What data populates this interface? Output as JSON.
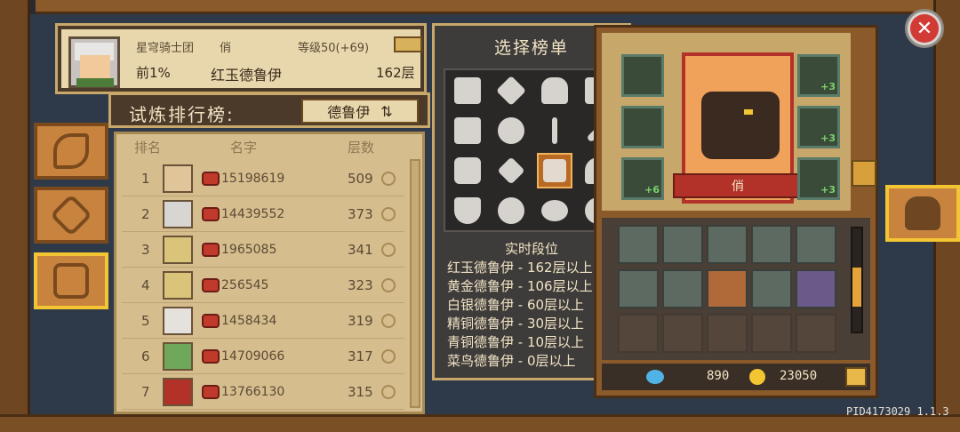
{
  "profile": {
    "guild": "星穹骑士团",
    "title": "俏",
    "level": "等级50(+69)",
    "rank": "前1%",
    "tier": "红玉德鲁伊",
    "floor": "162层"
  },
  "trial": {
    "label": "试炼排行榜:",
    "selected_class": "德鲁伊",
    "swap_icon": "swap-arrows-icon"
  },
  "leaderboard": {
    "headers": {
      "rank": "排名",
      "name": "名字",
      "floors": "层数"
    },
    "rows": [
      {
        "rank": "1",
        "uid": "15198619",
        "floors": "509"
      },
      {
        "rank": "2",
        "uid": "14439552",
        "floors": "373"
      },
      {
        "rank": "3",
        "uid": "1965085",
        "floors": "341"
      },
      {
        "rank": "4",
        "uid": "256545",
        "floors": "323"
      },
      {
        "rank": "5",
        "uid": "1458434",
        "floors": "319"
      },
      {
        "rank": "6",
        "uid": "14709066",
        "floors": "317"
      },
      {
        "rank": "7",
        "uid": "13766130",
        "floors": "315"
      }
    ]
  },
  "select_panel": {
    "title": "选择榜单",
    "live_label": "实时段位",
    "tiers": [
      "红玉德鲁伊 - 162层以上",
      "黄金德鲁伊 - 106层以上",
      "白银德鲁伊 - 60层以上",
      "精铜德鲁伊 - 30层以上",
      "青铜德鲁伊 - 10层以上",
      "菜鸟德鲁伊 - 0层以上"
    ],
    "class_icons": [
      "knight-class-icon",
      "compass-class-icon",
      "helmet-class-icon",
      "tower-class-icon",
      "castle-class-icon",
      "vortex-class-icon",
      "swords-class-icon",
      "blade-class-icon",
      "hexagon-class-icon",
      "star-class-icon",
      "druid-class-icon",
      "flame-class-icon",
      "shield-class-icon",
      "swirl-class-icon",
      "eye-class-icon",
      "spiral-class-icon"
    ],
    "selected_index": 10
  },
  "hero": {
    "name": "俏",
    "slot_bonuses": [
      "+3",
      "+3",
      "+3",
      "+6"
    ]
  },
  "resources": {
    "gems": "890",
    "coins": "23050"
  },
  "footer": {
    "pid": "PID4173029 1.1.3"
  },
  "colors": {
    "wood": "#8a5a2b",
    "parchment": "#e8d7ad",
    "accent_gold": "#f3c532",
    "ruby": "#b2322a",
    "close_red": "#d23a36"
  }
}
